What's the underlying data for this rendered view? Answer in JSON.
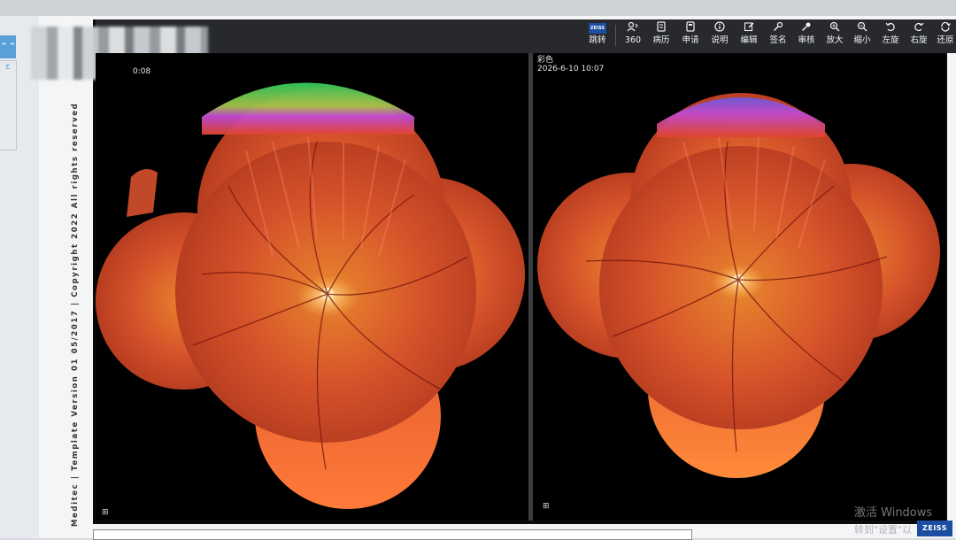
{
  "sidebar": {
    "tab_glyph": "⌃⌃",
    "tab2_glyph": "ε"
  },
  "copyright_text": "Meditec | Template Version 01 05/2017 | Copyright 2022 All rights reserved",
  "toolbar": {
    "brand_label": "ZEISS",
    "items": [
      {
        "label": "跳转",
        "icon": "zeiss-icon"
      },
      {
        "label": "360",
        "icon": "person-360-icon"
      },
      {
        "label": "病历",
        "icon": "record-icon"
      },
      {
        "label": "申请",
        "icon": "request-icon"
      },
      {
        "label": "说明",
        "icon": "info-icon"
      },
      {
        "label": "编辑",
        "icon": "edit-icon"
      },
      {
        "label": "签名",
        "icon": "sign-icon"
      },
      {
        "label": "审核",
        "icon": "review-icon"
      },
      {
        "label": "放大",
        "icon": "zoom-in-icon"
      },
      {
        "label": "缩小",
        "icon": "zoom-out-icon"
      },
      {
        "label": "左旋",
        "icon": "rotate-left-icon"
      },
      {
        "label": "右旋",
        "icon": "rotate-right-icon"
      },
      {
        "label": "还原",
        "icon": "reset-icon"
      }
    ]
  },
  "left_image": {
    "header_partial": "0:08",
    "icon": "grid-icon"
  },
  "right_image": {
    "mode": "彩色",
    "timestamp": "2026-6-10 10:07",
    "icon": "grid-icon"
  },
  "watermark": {
    "line1": "激活 Windows",
    "line2": "转到\"设置\"以"
  },
  "brand_color": "#1b4ea3"
}
